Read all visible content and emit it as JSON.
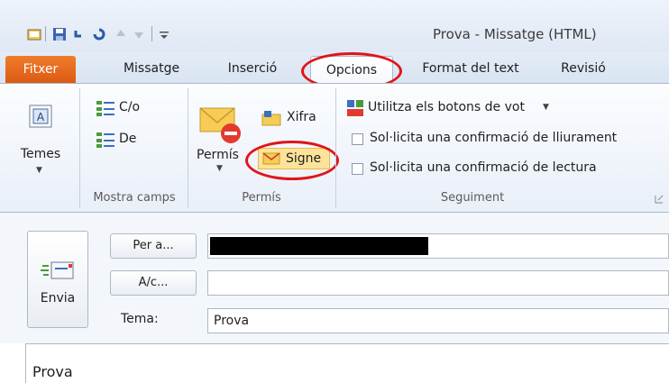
{
  "window": {
    "title": "Prova - Missatge (HTML)"
  },
  "qat": {
    "icons": [
      "outlook-icon",
      "save-icon",
      "undo-icon",
      "redo-icon",
      "up-arrow-icon",
      "down-arrow-icon",
      "customize-icon"
    ]
  },
  "tabs": [
    {
      "label": "Fitxer",
      "active": false
    },
    {
      "label": "Missatge",
      "active": false
    },
    {
      "label": "Inserció",
      "active": false
    },
    {
      "label": "Opcions",
      "active": true
    },
    {
      "label": "Format del text",
      "active": false
    },
    {
      "label": "Revisió",
      "active": false
    }
  ],
  "ribbon": {
    "themes": {
      "label": "Temes"
    },
    "show_fields": {
      "cc": "C/o",
      "from": "De",
      "group_label": "Mostra camps"
    },
    "permission": {
      "permission_label": "Permís",
      "encrypt": "Xifra",
      "sign": "Signe",
      "group_label": "Permís"
    },
    "tracking": {
      "voting": "Utilitza els botons de vot",
      "delivery": "Sol·licita una confirmació de lliurament",
      "read": "Sol·licita una confirmació de lectura",
      "group_label": "Seguiment"
    }
  },
  "message": {
    "send_label": "Envia",
    "to_button": "Per a...",
    "cc_button": "A/c...",
    "subject_label": "Tema:",
    "subject_value": "Prova",
    "to_value": "",
    "cc_value": "",
    "body_text": "Prova"
  },
  "colors": {
    "annotation": "#e0141a",
    "file_tab": "#e8671c"
  }
}
